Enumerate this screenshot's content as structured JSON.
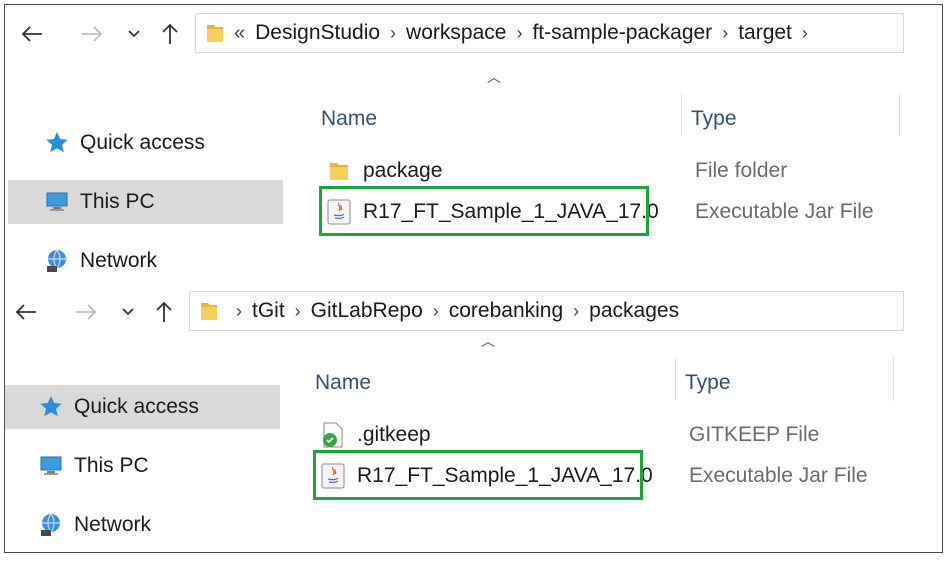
{
  "panes": [
    {
      "address": {
        "overflow_chevron": "«",
        "crumbs": [
          "DesignStudio",
          "workspace",
          "ft-sample-packager",
          "target"
        ]
      },
      "sidebar": [
        {
          "label": "Quick access",
          "icon": "star-icon",
          "selected": false
        },
        {
          "label": "This PC",
          "icon": "computer-icon",
          "selected": true
        },
        {
          "label": "Network",
          "icon": "network-icon",
          "selected": false
        }
      ],
      "columns": {
        "name": "Name",
        "type": "Type"
      },
      "files": [
        {
          "name": "package",
          "type": "File folder",
          "icon": "folder-icon",
          "highlighted": false
        },
        {
          "name": "R17_FT_Sample_1_JAVA_17.0",
          "type": "Executable Jar File",
          "icon": "java-jar-icon",
          "highlighted": true
        }
      ]
    },
    {
      "address": {
        "overflow_chevron": "",
        "crumbs": [
          "tGit",
          "GitLabRepo",
          "corebanking",
          "packages"
        ]
      },
      "sidebar": [
        {
          "label": "Quick access",
          "icon": "star-icon",
          "selected": true
        },
        {
          "label": "This PC",
          "icon": "computer-icon",
          "selected": false
        },
        {
          "label": "Network",
          "icon": "network-icon",
          "selected": false
        }
      ],
      "columns": {
        "name": "Name",
        "type": "Type"
      },
      "files": [
        {
          "name": ".gitkeep",
          "type": "GITKEEP File",
          "icon": "gitkeep-file-icon",
          "highlighted": false
        },
        {
          "name": "R17_FT_Sample_1_JAVA_17.0",
          "type": "Executable Jar File",
          "icon": "java-jar-icon",
          "highlighted": true
        }
      ]
    }
  ],
  "colors": {
    "highlight": "#1fa33a",
    "selected_bg": "#d9d9d9",
    "header_text": "#35516e"
  }
}
